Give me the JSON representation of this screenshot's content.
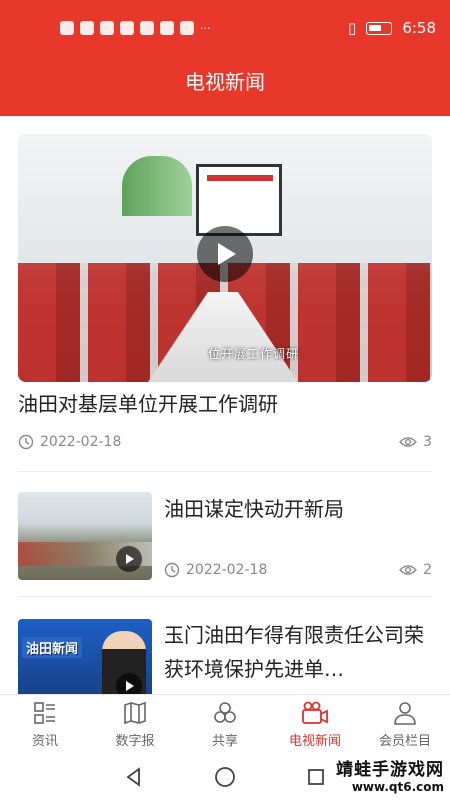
{
  "status_bar": {
    "time": "6:58"
  },
  "header": {
    "title": "电视新闻"
  },
  "hero": {
    "title": "油田对基层单位开展工作调研",
    "date": "2022-02-18",
    "views": "3",
    "video_caption": "位开展工作调研"
  },
  "items": [
    {
      "title": "油田谋定快动开新局",
      "date": "2022-02-18",
      "views": "2"
    },
    {
      "title": "玉门油田乍得有限责任公司荣获环境保护先进单…",
      "thumb_logo": "油田新闻"
    }
  ],
  "tabs": [
    {
      "label": "资讯",
      "icon": "news-grid-icon",
      "active": false
    },
    {
      "label": "数字报",
      "icon": "newspaper-icon",
      "active": false
    },
    {
      "label": "共享",
      "icon": "share-circles-icon",
      "active": false
    },
    {
      "label": "电视新闻",
      "icon": "video-camera-icon",
      "active": true
    },
    {
      "label": "会员栏目",
      "icon": "person-icon",
      "active": false
    }
  ],
  "watermark": {
    "name": "靖蛙手游戏网",
    "url": "www.qt6.com"
  },
  "colors": {
    "brand_red": "#e8382b",
    "active_tab": "#d9342a",
    "meta_gray": "#888888"
  }
}
